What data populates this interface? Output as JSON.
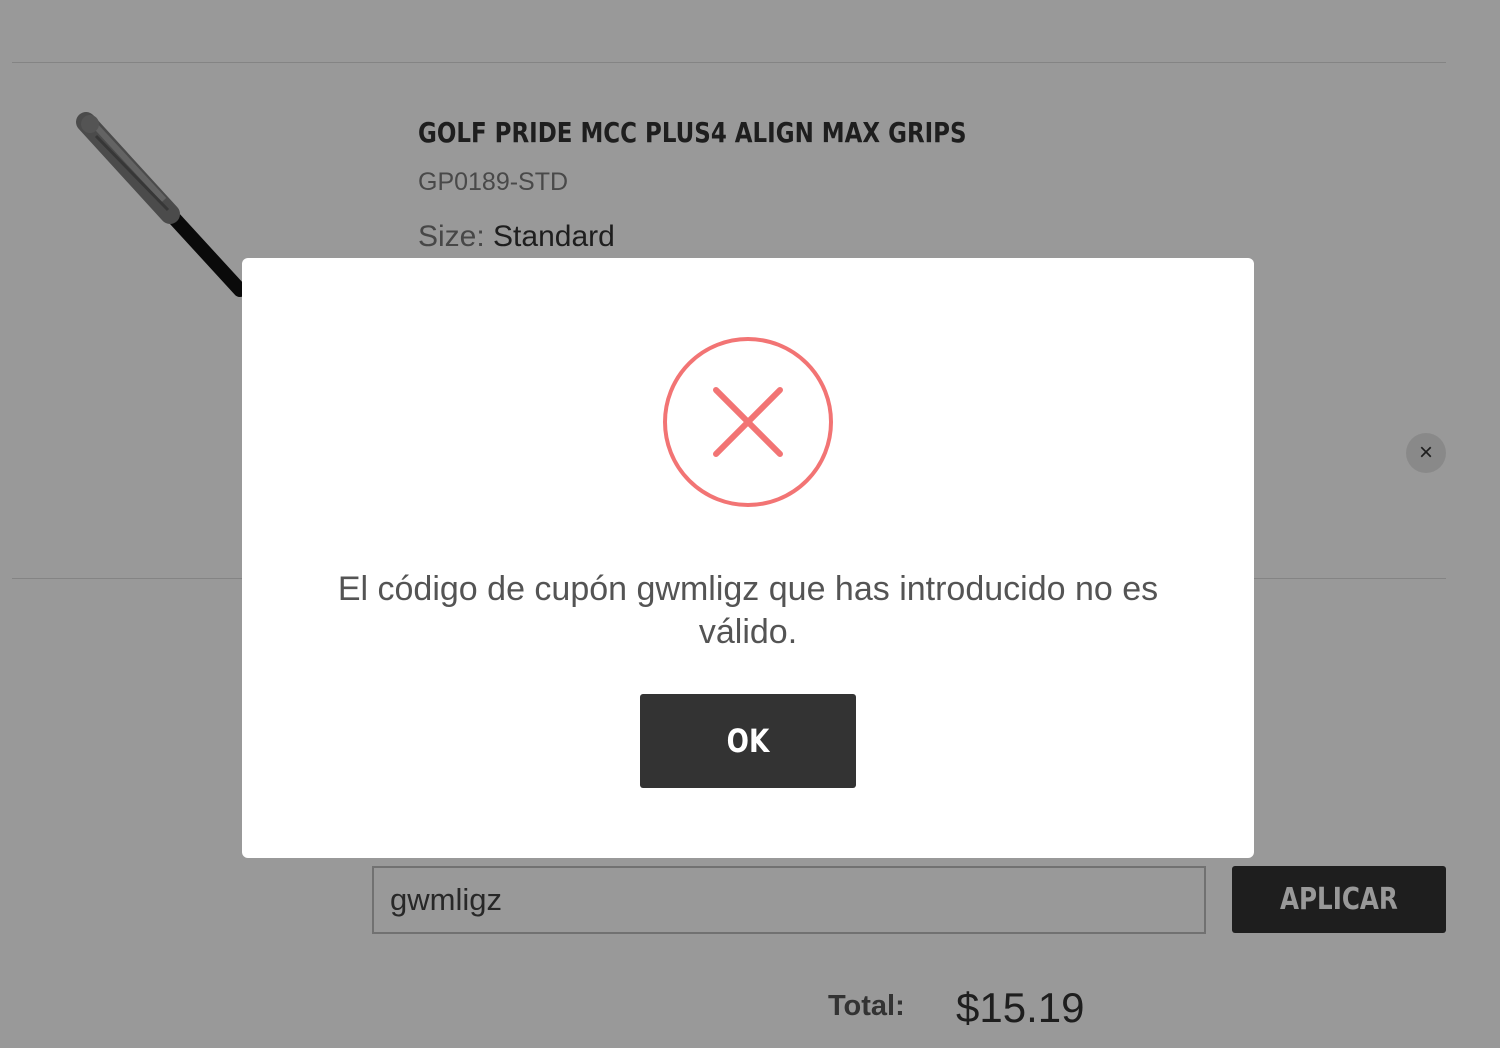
{
  "cart": {
    "item": {
      "name": "GOLF PRIDE MCC PLUS4 ALIGN MAX GRIPS",
      "sku": "GP0189-STD",
      "size_label": "Size:",
      "size_value": "Standard",
      "remove_icon": "close-icon",
      "remove_symbol": "×"
    },
    "coupon": {
      "value": "gwmligz",
      "apply_label": "APLICAR"
    },
    "total": {
      "label": "Total:",
      "value": "$15.19"
    }
  },
  "modal": {
    "icon": "error-x-icon",
    "message": "El código de cupón gwmligz que has introducido no es válido.",
    "ok_label": "OK",
    "colors": {
      "error": "#f27474",
      "button": "#333333"
    }
  }
}
